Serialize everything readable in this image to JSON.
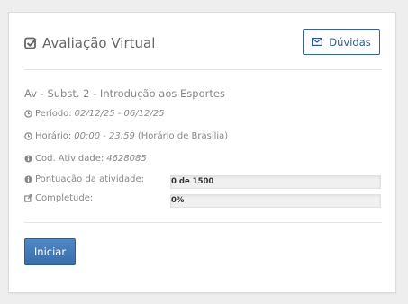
{
  "header": {
    "title": "Avaliação Virtual",
    "help_button_label": "Dúvidas"
  },
  "activity": {
    "title": "Av - Subst. 2 - Introdução aos Esportes",
    "periodo_label": "Período:",
    "periodo_value": "02/12/25 - 06/12/25",
    "horario_label": "Horário:",
    "horario_value": "00:00 - 23:59",
    "horario_tz": "(Horário de Brasília)",
    "codigo_label": "Cod. Atividade:",
    "codigo_value": "4628085",
    "pontuacao_label": "Pontuação da atividade:",
    "pontuacao_text": "0 de 1500",
    "pontuacao_fraction": 0.0,
    "completude_label": "Completude:",
    "completude_text": "0%",
    "completude_fraction": 0.0
  },
  "actions": {
    "start_label": "Iniciar"
  },
  "colors": {
    "primary": "#3a6fa8",
    "help_border": "#35639a",
    "icon_gray": "#888888"
  },
  "icons": {
    "header": "check-square-icon",
    "help": "envelope-icon",
    "periodo": "clock-icon",
    "horario": "clock-icon",
    "codigo": "info-icon",
    "pontuacao": "info-icon",
    "completude": "external-link-icon"
  }
}
